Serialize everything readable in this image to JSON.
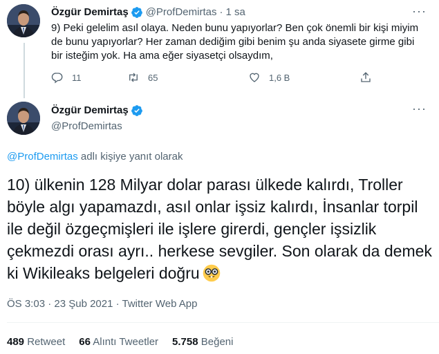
{
  "tweet1": {
    "name": "Özgür Demirtaş",
    "handle": "@ProfDemirtas",
    "separator": "·",
    "time": "1 sa",
    "text": "9) Peki gelelim asıl olaya. Neden bunu yapıyorlar? Ben çok önemli bir kişi miyim de bunu yapıyorlar? Her zaman dediğim gibi benim şu anda siyasete girme gibi bir isteğim yok. Ha ama eğer siyasetçi olsaydım,",
    "replies": "11",
    "retweets": "65",
    "likes": "1,6 B"
  },
  "tweet2": {
    "name": "Özgür Demirtaş",
    "handle": "@ProfDemirtas",
    "reply_mention": "@ProfDemirtas",
    "reply_suffix": " adlı kişiye yanıt olarak",
    "text": "10) ülkenin 128 Milyar dolar parası ülkede kalırdı, Troller böyle algı yapamazdı, asıl onlar işsiz kalırdı, İnsanlar torpil ile değil özgeçmişleri ile işlere girerdi, gençler işsizlik çekmezdi orası ayrı.. herkese sevgiler. Son olarak da demek ki Wikileaks belgeleri doğru",
    "meta": "ÖS 3:03 · 23 Şub 2021 · Twitter Web App",
    "stats": [
      {
        "count": "489",
        "label": "Retweet"
      },
      {
        "count": "66",
        "label": "Alıntı Tweetler"
      },
      {
        "count": "5.758",
        "label": "Beğeni"
      }
    ]
  },
  "icons": [
    "verified-badge-icon",
    "more-icon",
    "reply-icon",
    "retweet-icon",
    "like-icon",
    "share-icon",
    "nerd-face-emoji"
  ],
  "colors": {
    "accent": "#1d9bf0",
    "muted": "#536471",
    "text": "#0f1419",
    "divider": "#eff3f4"
  }
}
